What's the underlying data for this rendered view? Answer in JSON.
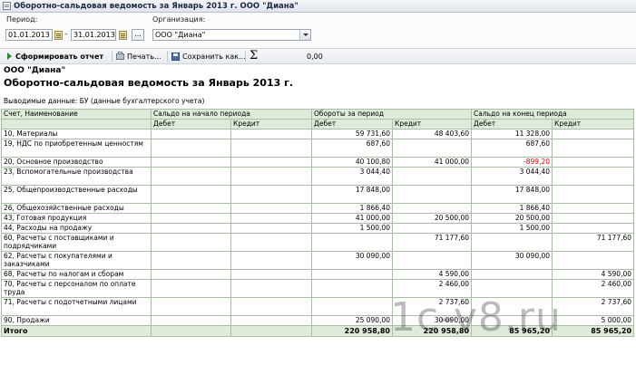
{
  "window": {
    "title": "Оборотно-сальдовая ведомость за Январь 2013 г. ООО \"Диана\""
  },
  "params": {
    "period_label": "Период:",
    "date_from": "01.01.2013",
    "dash": "–",
    "date_to": "31.01.2013",
    "dots": "...",
    "org_label": "Организация:",
    "org_value": "ООО \"Диана\""
  },
  "toolbar": {
    "generate": "Сформировать отчет",
    "print": "Печать...",
    "save": "Сохранить как...",
    "sigma": "Σ",
    "sum": "0,00"
  },
  "report": {
    "org": "ООО \"Диана\"",
    "title": "Оборотно-сальдовая ведомость за Январь 2013 г.",
    "shown": "Выводимые данные:  БУ (данные бухгалтерского учета)",
    "headers": {
      "account": "Счет, Наименование",
      "opening": "Сальдо на начало периода",
      "turnover": "Обороты за период",
      "closing": "Сальдо на конец периода",
      "debit": "Дебет",
      "credit": "Кредит"
    },
    "rows": [
      {
        "name": "10, Материалы",
        "od": "",
        "oc": "",
        "td": "59 731,60",
        "tc": "48 403,60",
        "cd": "11 328,00",
        "cc": ""
      },
      {
        "name": "19, НДС по приобретенным ценностям",
        "od": "",
        "oc": "",
        "td": "687,60",
        "tc": "",
        "cd": "687,60",
        "cc": ""
      },
      {
        "name": "20, Основное производство",
        "od": "",
        "oc": "",
        "td": "40 100,80",
        "tc": "41 000,00",
        "cd": "-899,20",
        "cc": ""
      },
      {
        "name": "23, Вспомогательные производства",
        "od": "",
        "oc": "",
        "td": "3 044,40",
        "tc": "",
        "cd": "3 044,40",
        "cc": ""
      },
      {
        "name": "25, Общепроизводственные расходы",
        "od": "",
        "oc": "",
        "td": "17 848,00",
        "tc": "",
        "cd": "17 848,00",
        "cc": ""
      },
      {
        "name": "26, Общехозяйственные расходы",
        "od": "",
        "oc": "",
        "td": "1 866,40",
        "tc": "",
        "cd": "1 866,40",
        "cc": ""
      },
      {
        "name": "43, Готовая продукция",
        "od": "",
        "oc": "",
        "td": "41 000,00",
        "tc": "20 500,00",
        "cd": "20 500,00",
        "cc": ""
      },
      {
        "name": "44, Расходы на продажу",
        "od": "",
        "oc": "",
        "td": "1 500,00",
        "tc": "",
        "cd": "1 500,00",
        "cc": ""
      },
      {
        "name": "60, Расчеты с поставщиками и подрядчиками",
        "od": "",
        "oc": "",
        "td": "",
        "tc": "71 177,60",
        "cd": "",
        "cc": "71 177,60"
      },
      {
        "name": "62, Расчеты с покупателями и заказчиками",
        "od": "",
        "oc": "",
        "td": "30 090,00",
        "tc": "",
        "cd": "30 090,00",
        "cc": ""
      },
      {
        "name": "68, Расчеты по налогам и сборам",
        "od": "",
        "oc": "",
        "td": "",
        "tc": "4 590,00",
        "cd": "",
        "cc": "4 590,00"
      },
      {
        "name": "70, Расчеты с персоналом по оплате труда",
        "od": "",
        "oc": "",
        "td": "",
        "tc": "2 460,00",
        "cd": "",
        "cc": "2 460,00"
      },
      {
        "name": "71, Расчеты с подотчетными лицами",
        "od": "",
        "oc": "",
        "td": "",
        "tc": "2 737,60",
        "cd": "",
        "cc": "2 737,60"
      },
      {
        "name": "90, Продажи",
        "od": "",
        "oc": "",
        "td": "25 090,00",
        "tc": "30 090,00",
        "cd": "",
        "cc": "5 000,00"
      }
    ],
    "total": {
      "name": "Итого",
      "od": "",
      "oc": "",
      "td": "220 958,80",
      "tc": "220 958,80",
      "cd": "85 965,20",
      "cc": "85 965,20"
    }
  },
  "watermark": "1c-v8.ru",
  "colors": {
    "header_bg": "#dfeadb",
    "grid_line": "#a7bfa2",
    "negative": "#e00000",
    "run_icon": "#2a8a2a"
  }
}
